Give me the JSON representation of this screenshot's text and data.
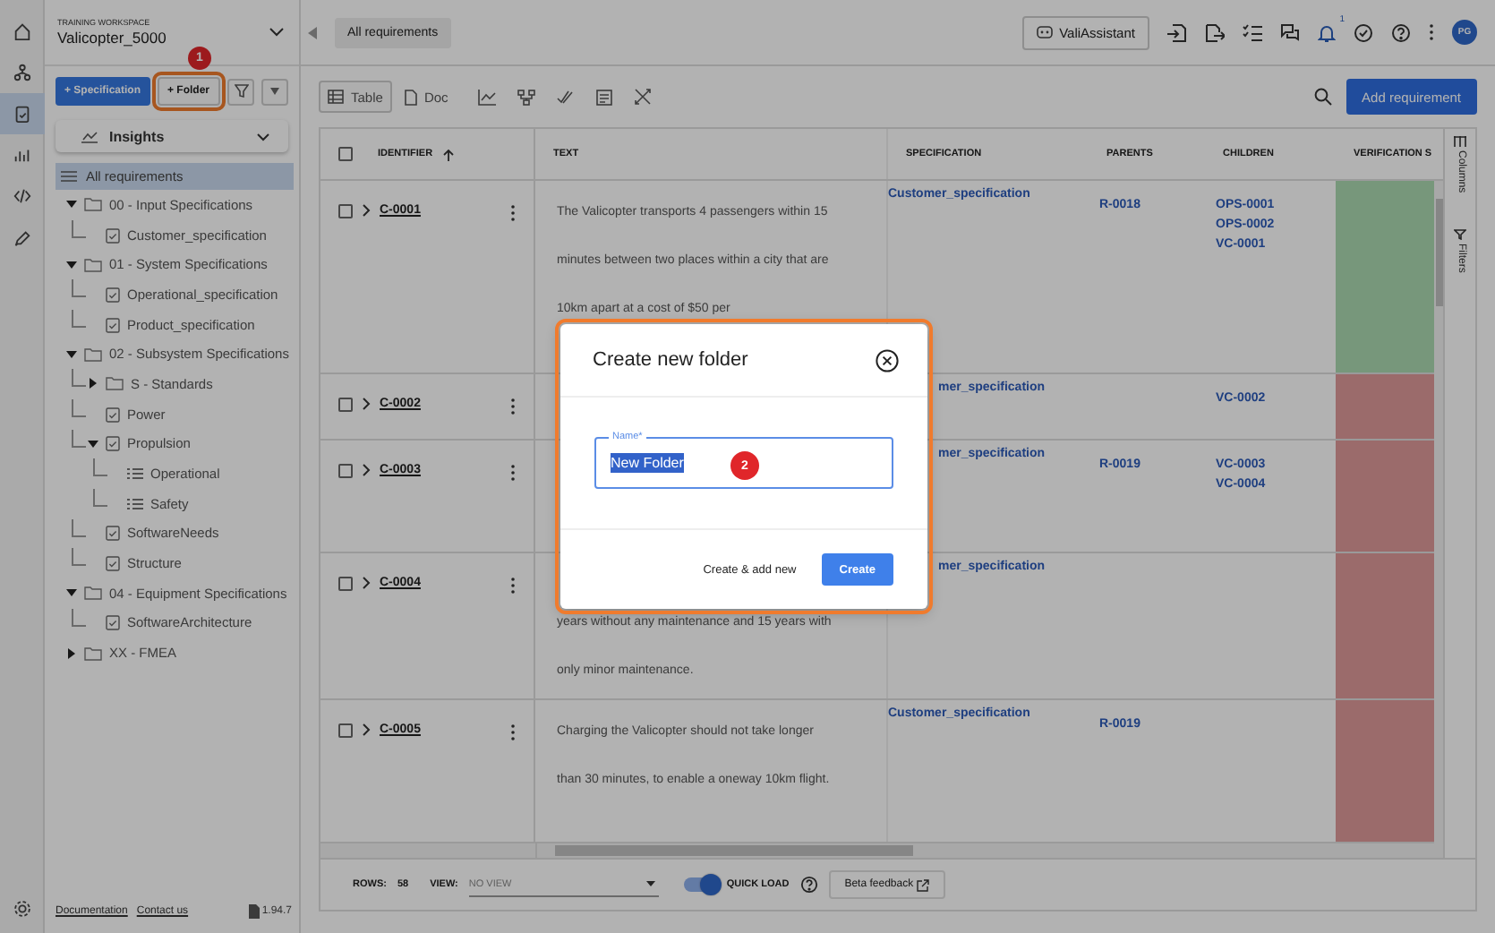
{
  "rail": [
    {
      "selected": false
    },
    {
      "selected": false
    },
    {
      "selected": true
    },
    {
      "selected": false
    },
    {
      "selected": false
    },
    {
      "selected": false
    }
  ],
  "workspace": {
    "label": "TRAINING WORKSPACE",
    "name": "Valicopter_5000"
  },
  "sidebar": {
    "buttons": [
      "+ Specification",
      "+ Folder"
    ],
    "insights": "Insights",
    "all": {
      "label": "All requirements",
      "selected": true
    },
    "tree": [
      {
        "kind": "folder",
        "label": "00 - Input Specifications",
        "expanded": true,
        "children": [
          {
            "kind": "spec",
            "label": "Customer_specification"
          }
        ]
      },
      {
        "kind": "folder",
        "label": "01 - System Specifications",
        "expanded": true,
        "children": [
          {
            "kind": "spec",
            "label": "Operational_specification"
          },
          {
            "kind": "spec",
            "label": "Product_specification"
          }
        ]
      },
      {
        "kind": "folder",
        "label": "02 - Subsystem Specifications",
        "expanded": true,
        "children": [
          {
            "kind": "folder",
            "label": "S - Standards",
            "expanded": false
          },
          {
            "kind": "spec",
            "label": "Power"
          },
          {
            "kind": "spec",
            "label": "Propulsion",
            "expanded": true,
            "children": [
              {
                "kind": "list",
                "label": "Operational"
              },
              {
                "kind": "list",
                "label": "Safety"
              }
            ]
          },
          {
            "kind": "spec",
            "label": "SoftwareNeeds"
          },
          {
            "kind": "spec",
            "label": "Structure"
          }
        ]
      },
      {
        "kind": "folder",
        "label": "04 - Equipment Specifications",
        "expanded": true,
        "children": [
          {
            "kind": "spec",
            "label": "SoftwareArchitecture"
          }
        ]
      },
      {
        "kind": "folder",
        "label": "XX - FMEA",
        "expanded": false
      }
    ],
    "footer": {
      "links": [
        "Documentation",
        "Contact us"
      ],
      "version": "1.94.7"
    }
  },
  "topbar": {
    "breadcrumb": "All requirements",
    "assistant": "ValiAssistant",
    "notifications": "1",
    "avatar": "PG"
  },
  "views": [
    {
      "label": "Table",
      "selected": true
    },
    {
      "label": "Doc",
      "selected": false
    }
  ],
  "add_button": "Add requirement",
  "table": {
    "select_all_checked": false,
    "columns": [
      "IDENTIFIER",
      "TEXT",
      "SPECIFICATION",
      "PARENTS",
      "CHILDREN",
      "VERIFICATION S"
    ],
    "rows": [
      {
        "id": "C-0001",
        "text": "The Valicopter transports 4 passengers within 15 minutes between two places within a city that are 10km apart at a cost of $50 per",
        "specification": "Customer_specification",
        "parents": [
          "R-0018"
        ],
        "children": [
          "OPS-0001",
          "OPS-0002",
          "VC-0001"
        ],
        "color": "#77977b",
        "covered": false,
        "checked": false
      },
      {
        "id": "C-0002",
        "specification": "mer_specification",
        "parents": [],
        "children": [
          "VC-0002"
        ],
        "color": "#9b6b6b",
        "covered": true,
        "checked": false
      },
      {
        "id": "C-0003",
        "specification": "mer_specification",
        "parents": [
          "R-0019"
        ],
        "children": [
          "VC-0003",
          "VC-0004"
        ],
        "color": "#9b6b6b",
        "covered": true,
        "checked": false
      },
      {
        "id": "C-0004",
        "text": "years without any maintenance and 15 years with only minor maintenance.",
        "specification": "mer_specification",
        "parents": [],
        "children": [],
        "color": "#9b6b6b",
        "covered": true,
        "checked": false
      },
      {
        "id": "C-0005",
        "text": "Charging the Valicopter should not take longer than 30 minutes, to enable a oneway 10km flight.",
        "specification": "Customer_specification",
        "parents": [
          "R-0019"
        ],
        "children": [],
        "color": "#9b6b6b",
        "covered": false,
        "checked": false
      }
    ],
    "side_tabs": [
      "Columns",
      "Filters"
    ]
  },
  "statusbar": {
    "rows_label": "ROWS:",
    "rows": "58",
    "view_label": "VIEW:",
    "view_placeholder": "NO VIEW",
    "quick_load": {
      "label": "QUICK LOAD",
      "on": true
    },
    "feedback": "Beta feedback"
  },
  "dialog": {
    "title": "Create new folder",
    "field_label": "Name*",
    "value": "New Folder",
    "buttons": [
      "Create & add new",
      "Create"
    ]
  },
  "markers": [
    "1",
    "2"
  ]
}
